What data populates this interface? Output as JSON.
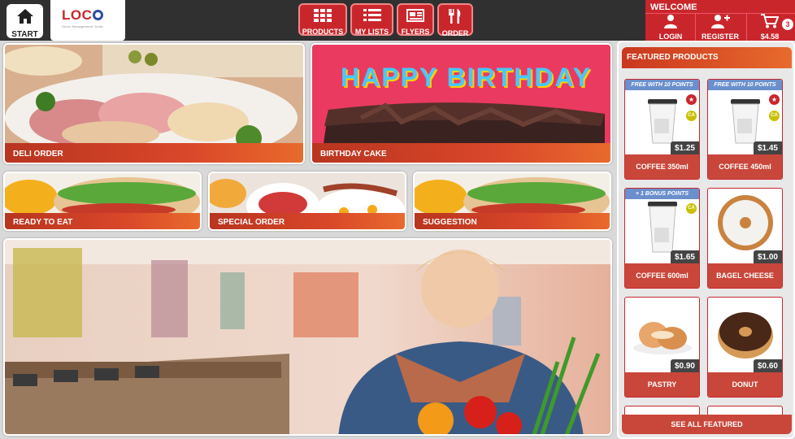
{
  "topbar": {
    "start_label": "START",
    "logo_text": "LOC",
    "logo_tagline": "Store Management Suite",
    "nav": [
      {
        "label": "PRODUCTS",
        "icon": "grid-icon"
      },
      {
        "label": "MY LISTS",
        "icon": "list-icon"
      },
      {
        "label": "FLYERS",
        "icon": "newspaper-icon"
      },
      {
        "label": "ORDER",
        "icon": "fork-knife-icon"
      }
    ]
  },
  "account": {
    "welcome": "WELCOME",
    "login": "LOGIN",
    "register": "REGISTER",
    "cart_total": "$4.58",
    "cart_count": "3"
  },
  "tiles": {
    "deli": "DELI ORDER",
    "birthday": "BIRTHDAY CAKE",
    "birthday_sign": "HAPPY BIRTHDAY",
    "ready": "READY TO EAT",
    "special": "SPECIAL ORDER",
    "suggestion": "SUGGESTION"
  },
  "featured": {
    "title": "FEATURED PRODUCTS",
    "see_all": "SEE ALL FEATURED",
    "products": [
      {
        "name": "COFFEE 350ml",
        "price": "$1.25",
        "promo": "FREE WITH 10 POINTS"
      },
      {
        "name": "COFFEE 450ml",
        "price": "$1.45",
        "promo": "FREE WITH 10 POINTS"
      },
      {
        "name": "COFFEE 600ml",
        "price": "$1.65",
        "promo": "+ 1 BONUS POINTS"
      },
      {
        "name": "BAGEL CHEESE",
        "price": "$1.00",
        "promo": ""
      },
      {
        "name": "PASTRY",
        "price": "$0.90",
        "promo": ""
      },
      {
        "name": "DONUT",
        "price": "$0.60",
        "promo": ""
      }
    ],
    "star_glyph": "★",
    "ca_label": "CA"
  },
  "colors": {
    "brand_red": "#c9262c",
    "accent_orange": "#e86a2c",
    "promo_blue": "#6a8fcc"
  }
}
